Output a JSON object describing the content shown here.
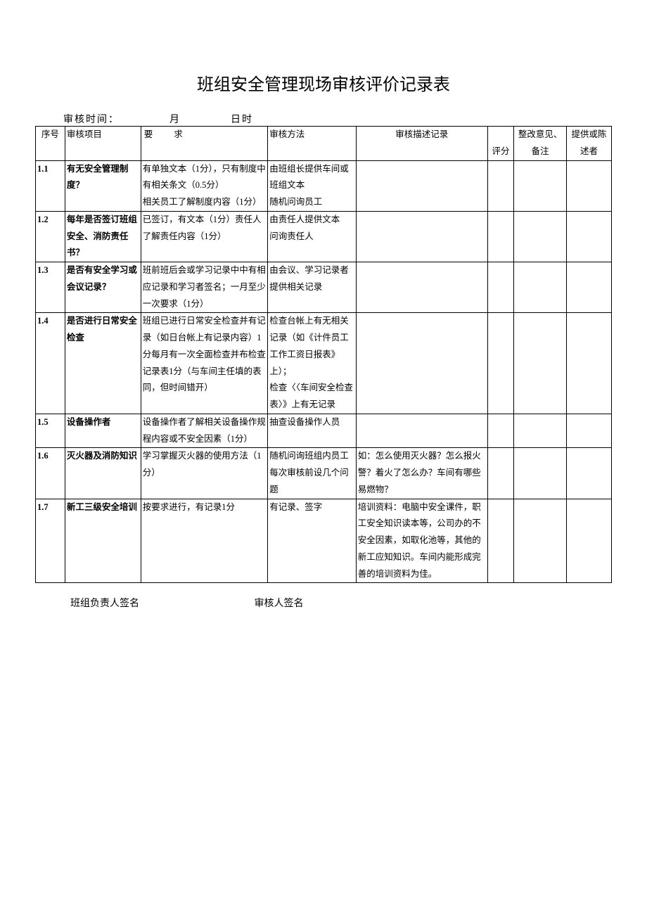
{
  "title": "班组安全管理现场审核评价记录表",
  "audit_time": {
    "label": "审核时间：",
    "month_label": "月",
    "day_label": "日时"
  },
  "headers": {
    "num": "序号",
    "item": "审核项目",
    "req": "要求",
    "method": "审核方法",
    "desc": "审核描述记录",
    "score": "评分",
    "remark": "整改意见、备注",
    "provider": "提供或陈述者"
  },
  "rows": [
    {
      "num": "1.1",
      "item": "有无安全管理制度？",
      "req": "有单独文本（1分），只有制度中有相关条文（0.5分）\n相关员工了解制度内容（1分）",
      "method": "由班组长提供车间或班组文本\n随机问询员工",
      "desc": "",
      "score": "",
      "remark": "",
      "provider": ""
    },
    {
      "num": "1.2",
      "item": "每年是否签订班组安全、消防责任书？",
      "req": "已签订，有文本（1分）责任人了解责任内容（1分）",
      "method": "由责任人提供文本\n问询责任人",
      "desc": "",
      "score": "",
      "remark": "",
      "provider": ""
    },
    {
      "num": "1.3",
      "item": "是否有安全学习或会议记录？",
      "req": "班前班后会或学习记录中中有相应记录和学习者签名；一月至少一次要求（1分）",
      "method": "由会议、学习记录者提供相关记录",
      "desc": "",
      "score": "",
      "remark": "",
      "provider": ""
    },
    {
      "num": "1.4",
      "item": "是否进行日常安全检查",
      "req": "班组已进行日常安全检查并有记录（如日台帐上有记录内容）1分每月有一次全面检查并布检查记录表1分（与车间主任填的表同，但时间错开）",
      "method": "检查台帐上有无相关记录（如《计件员工工作工资日报表》上）；\n检查〈〈车间安全检查表〉》上有无记录",
      "desc": "",
      "score": "",
      "remark": "",
      "provider": ""
    },
    {
      "num": "1.5",
      "item": "设备操作者",
      "req": "设备操作者了解相关设备操作规程内容或不安全因素（1分）",
      "method": "抽查设备操作人员",
      "desc": "",
      "score": "",
      "remark": "",
      "provider": ""
    },
    {
      "num": "1.6",
      "item": "灭火器及消防知识",
      "req": "学习掌握灭火器的使用方法（1分）",
      "method": "随机问询班组内员工\n每次审核前设几个问题",
      "desc": "如：怎么使用灭火器？怎么报火警？着火了怎么办？车间有哪些易燃物？",
      "score": "",
      "remark": "",
      "provider": ""
    },
    {
      "num": "1.7",
      "item": "新工三级安全培训",
      "req": "按要求进行，有记录1分",
      "method": "有记录、签字",
      "desc": "培训资料：电脑中安全课件，职工安全知识读本等，公司办的不安全因素，如取化池等，其他的新工应知知识。车间内能形成完善的培训资料为佳。",
      "score": "",
      "remark": "",
      "provider": ""
    }
  ],
  "sign": {
    "left": "班组负责人签名",
    "right": "审核人签名"
  }
}
